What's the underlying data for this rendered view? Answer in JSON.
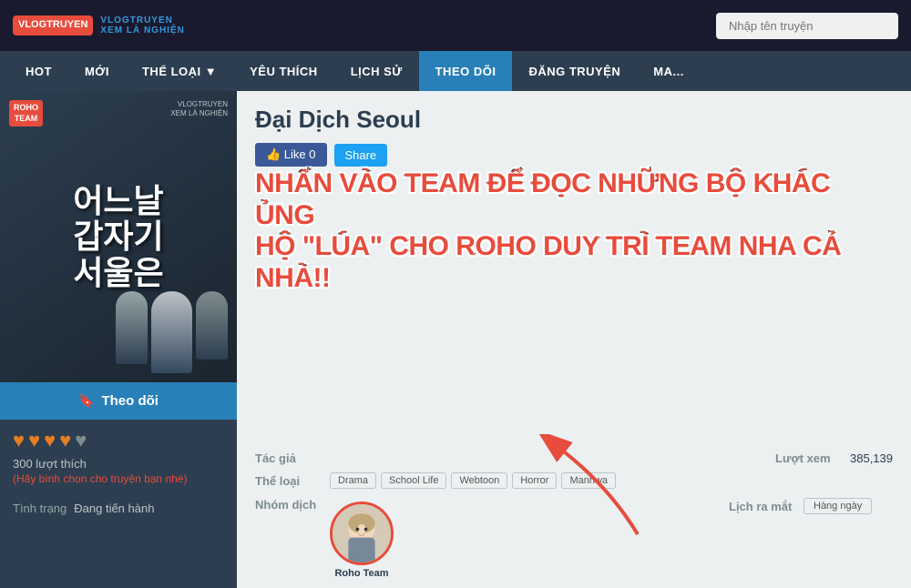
{
  "header": {
    "logo_main": "VLOGTRUYEN",
    "logo_sub": "XEM LÀ NGHIỆN",
    "search_placeholder": "Nhập tên truyện"
  },
  "nav": {
    "items": [
      {
        "label": "HOT",
        "active": false
      },
      {
        "label": "MỚI",
        "active": false
      },
      {
        "label": "THỂ LOẠI ▼",
        "active": false
      },
      {
        "label": "YÊU THÍCH",
        "active": false
      },
      {
        "label": "LỊCH SỬ",
        "active": false
      },
      {
        "label": "THEO DÕI",
        "active": true
      },
      {
        "label": "ĐĂNG TRUYỆN",
        "active": false
      },
      {
        "label": "MA...",
        "active": false
      }
    ]
  },
  "manga": {
    "title": "Đại Dịch Seoul",
    "korean_title": "어느날\n갑자기\n서울은",
    "roho_badge_line1": "ROHO",
    "roho_badge_line2": "TEAM",
    "vlogtruyen_label1": "VLOGTRUYEN",
    "vlogtruyen_label2": "XEM LÀ NGHIỆN",
    "like_btn_label": "👍 Like 0",
    "share_btn_label": "Share",
    "promo_line1": "NHẤN VÀO TEAM ĐỂ ĐỌC NHỮNG BỘ KHÁC ỦNG",
    "promo_line2": "HỘ \"LÚA\" CHO ROHO DUY TRÌ TEAM NHA CẢ NHÀ!!",
    "author_label": "Tác giả",
    "author_value": "",
    "views_label": "Lượt xem",
    "views_value": "385,139",
    "genre_label": "Thể loại",
    "genres": [
      "Drama",
      "School Life",
      "Webtoon",
      "Horror",
      "Manhwa"
    ],
    "translator_label": "Nhóm dịch",
    "team_name": "Roho Team",
    "release_label": "Lịch ra mắt",
    "release_value": "Hàng ngày",
    "follow_btn_label": "Theo dõi",
    "likes_count": "300 lượt thích",
    "vote_text": "(Hãy bình chọn cho truyện bạn nhé)",
    "status_label": "Tình trạng",
    "status_value": "Đang tiến hành"
  }
}
